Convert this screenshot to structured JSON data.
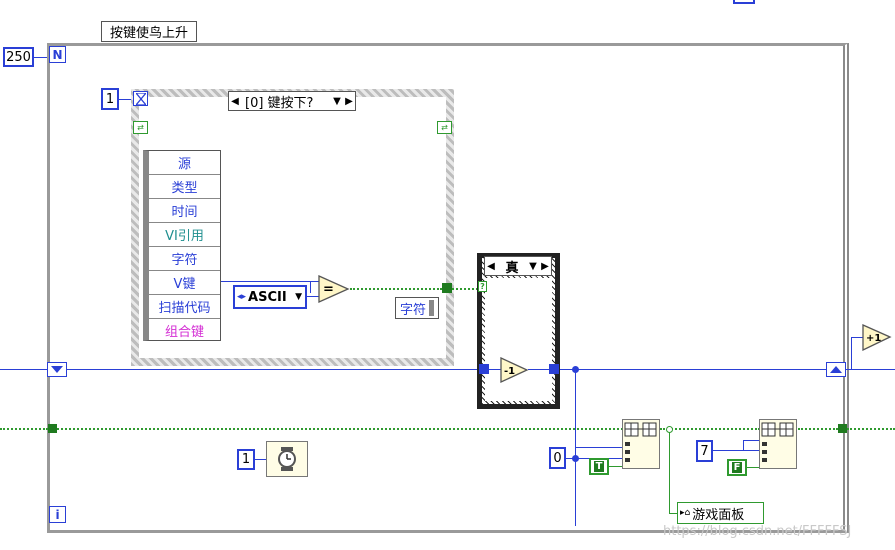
{
  "labels": {
    "loop_label": "按键使鸟上升",
    "loop_count": "250",
    "loop_n": "N",
    "loop_i": "i",
    "timeout_const": "1",
    "event_case_selector": "[0] 键按下?",
    "case_selector": "真",
    "wait_const": "1",
    "zero_const": "0",
    "seven_const": "7",
    "true_const": "T",
    "false_const": "F",
    "ascii_dropdown": "ASCII",
    "char_indicator": "字符",
    "game_panel_ref": "游戏面板",
    "decrement_symbol": "-1",
    "increment_symbol": "+1",
    "equal_symbol": "=",
    "watermark": "https://blog.csdn.net/FFFFFSJ"
  },
  "event_data_nodes": [
    {
      "text": "源",
      "color": "#2a3fd6"
    },
    {
      "text": "类型",
      "color": "#2a3fd6"
    },
    {
      "text": "时间",
      "color": "#2a3fd6"
    },
    {
      "text": "VI引用",
      "color": "#1f8f8f"
    },
    {
      "text": "字符",
      "color": "#2a3fd6"
    },
    {
      "text": "V键",
      "color": "#2a3fd6"
    },
    {
      "text": "扫描代码",
      "color": "#2a3fd6"
    },
    {
      "text": "组合键",
      "color": "#d42fd4"
    }
  ],
  "icons": {
    "hourglass": "hourglass-icon",
    "wait": "wait-ms-icon",
    "stop_arrow": "shift-register-icon",
    "array_replace": "replace-array-subset-icon",
    "property_arrow": "property-node-icon"
  },
  "colors": {
    "numeric_wire": "#2a3fd6",
    "boolean_wire": "#2f9a2f",
    "string_wire": "#9b4cc0"
  }
}
